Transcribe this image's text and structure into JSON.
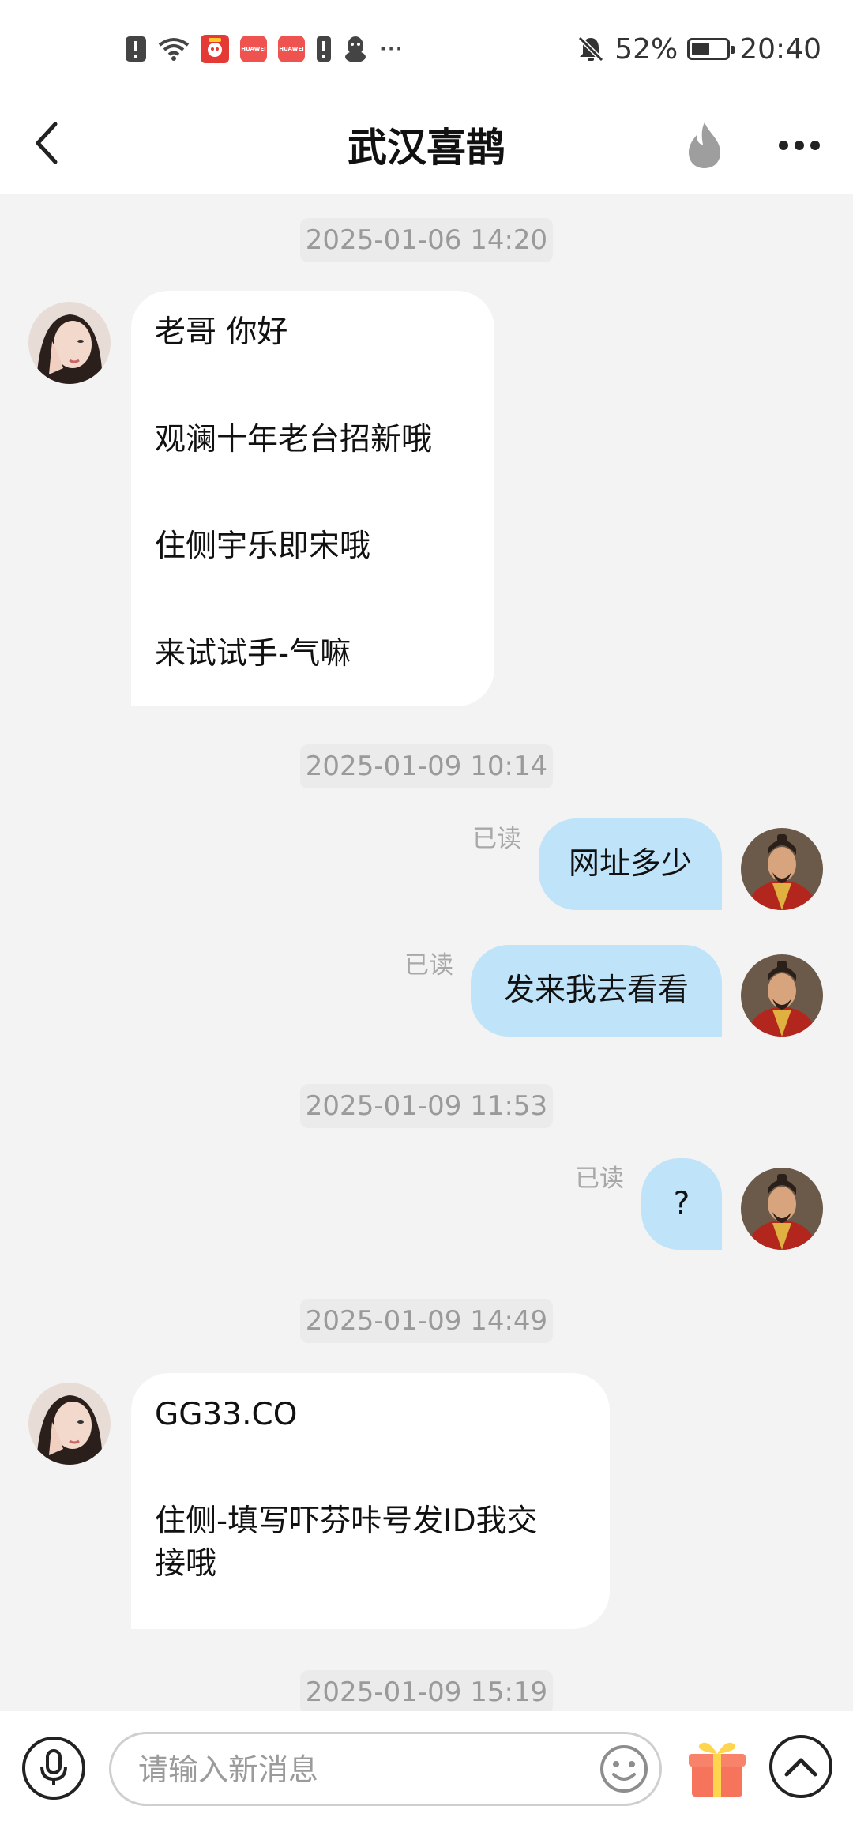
{
  "status_bar": {
    "battery_percent": "52%",
    "battery_level": 0.52,
    "time": "20:40",
    "huawei_label": "HUAWEI",
    "more_dots": "···"
  },
  "header": {
    "title": "武汉喜鹊",
    "icons": {
      "back": "chevron-left-icon",
      "fire": "fire-icon",
      "more": "more-dots-icon"
    }
  },
  "messages": {
    "ts1": "2025-01-06 14:20",
    "m1": {
      "sender": "other",
      "lines": [
        "老哥 你好",
        "观澜十年老台招新哦",
        "住侧宇乐即宋哦",
        "来试试手-气嘛"
      ]
    },
    "ts2": "2025-01-09 10:14",
    "m2": {
      "sender": "self",
      "text": "网址多少",
      "status": "已读"
    },
    "m3": {
      "sender": "self",
      "text": "发来我去看看",
      "status": "已读"
    },
    "ts3": "2025-01-09 11:53",
    "m4": {
      "sender": "self",
      "text": "?",
      "status": "已读"
    },
    "ts4": "2025-01-09 14:49",
    "m5": {
      "sender": "other",
      "lines": [
        "GG33.CO",
        "住侧-填写吓芬咔号发ID我交",
        "接哦"
      ]
    },
    "ts5": "2025-01-09 15:19"
  },
  "input": {
    "placeholder": "请输入新消息",
    "icons": {
      "voice": "microphone-icon",
      "emoji": "emoji-icon",
      "gift": "gift-icon",
      "expand": "chevron-up-icon"
    }
  },
  "colors": {
    "bubble_self": "#bfe3f8",
    "bubble_other": "#ffffff",
    "background": "#f3f3f3",
    "timestamp_bg": "#ebebeb"
  }
}
